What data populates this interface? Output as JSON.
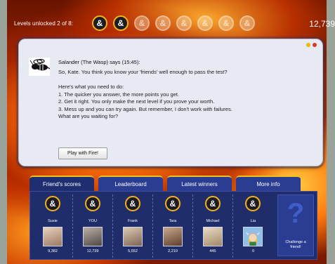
{
  "header": {
    "levels_label": "Levels unlocked 2 of 8:",
    "level_icons": [
      {
        "state": "unlocked",
        "glyph": "&"
      },
      {
        "state": "unlocked",
        "glyph": "&"
      },
      {
        "state": "locked",
        "glyph": "&"
      },
      {
        "state": "locked",
        "glyph": "&"
      },
      {
        "state": "locked",
        "glyph": "&"
      },
      {
        "state": "locked",
        "glyph": "&"
      },
      {
        "state": "locked",
        "glyph": "&"
      },
      {
        "state": "locked",
        "glyph": "&"
      }
    ],
    "score": "12,739"
  },
  "dialog": {
    "speaker": "Salander (The Wasp) says (15:45):",
    "avatar_icon": "wasp-icon",
    "lines": [
      "So, Kate. You think you know your 'friends' well enough to pass the test?",
      "",
      "Here's what you need to do:",
      "1. The quicker you answer, the more points you get.",
      "2. Get it right. You only make the next level if you prove your worth.",
      "3. Mess up and you can try again. But remember, I don't work with failures.",
      "What are you waiting for?"
    ],
    "play_button": "Play with Fire!"
  },
  "tabs": [
    {
      "label": "Friend's scores",
      "active": true
    },
    {
      "label": "Leaderboard",
      "active": false
    },
    {
      "label": "Latest winners",
      "active": false
    },
    {
      "label": "More info",
      "active": false
    }
  ],
  "friends": [
    {
      "name": "Susie",
      "score": "9,382",
      "photo_color": "#c9a68a"
    },
    {
      "name": "YOU",
      "score": "12,739",
      "photo_color": "#8a7a70"
    },
    {
      "name": "Frank",
      "score": "5,552",
      "photo_color": "#b89a80"
    },
    {
      "name": "Tara",
      "score": "2,210",
      "photo_color": "#a07860"
    },
    {
      "name": "Michael",
      "score": "445",
      "photo_color": "#c8b090"
    },
    {
      "name": "Lia",
      "score": "0",
      "photo_color": "#7fb0e0"
    }
  ],
  "challenge": {
    "glyph": "?",
    "label_line1": "Challenge a",
    "label_line2": "friend!"
  },
  "colors": {
    "panel": "#1f2d6a",
    "tab": "#2a3d92",
    "accent": "#f2c11c"
  }
}
